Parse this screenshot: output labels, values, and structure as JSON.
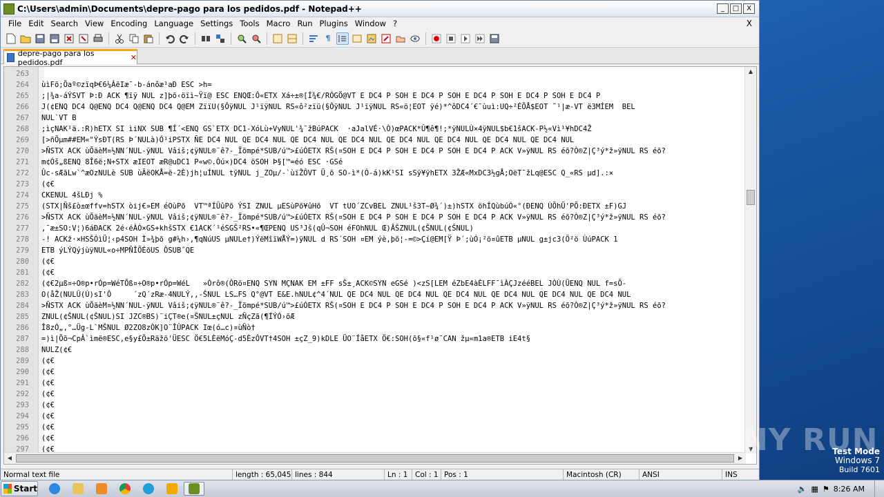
{
  "window": {
    "title": "C:\\Users\\admin\\Documents\\depre-pago para los pedidos.pdf - Notepad++",
    "min": "_",
    "max": "□",
    "close": "X"
  },
  "menu": {
    "items": [
      "File",
      "Edit",
      "Search",
      "View",
      "Encoding",
      "Language",
      "Settings",
      "Tools",
      "Macro",
      "Run",
      "Plugins",
      "Window",
      "?"
    ],
    "close": "X"
  },
  "tab": {
    "label": "depre-pago para los pedidos.pdf",
    "close": "✕"
  },
  "editor": {
    "lines": [
      {
        "n": "263",
        "t": ""
      },
      {
        "n": "264",
        "t": "ùìFõ;Õaº©zïqÞ€6¼ÁëIæ¯-b-ánôæ¹aÐ ESC >h="
      },
      {
        "n": "265",
        "t": ";|¾a-áÝSVT Þ:Ð ACK ¶ïÿ NUL z]þõ‹öïì~Ÿï@ ESC ENQŒ:Ô«ETX Xá÷±®[Í¾€/RÓGÖ@VT E DC4 P SOH E DC4 P SOH E DC4 P SOH E DC4 P SOH E DC4 P"
      },
      {
        "n": "266",
        "t": "J(¢ENQ DC4 Q@ENQ DC4 Q@ENQ DC4 Q@EM ZïïU(§ÔÿNUL J¹ïÿNUL RS«ô²zïü(§ÔÿNUL J¹ïÿNUL RS«ö¦EOT ÿé)*^ôDC4´€¯ùuì:UQ÷²ÉÕÅ$EOT ˜¹|æ-VT ë3MÍEM  BEL"
      },
      {
        "n": "267",
        "t": "NUL`VT B"
      },
      {
        "n": "268",
        "t": ";ìçNAK¹ä.:R)hETX SI ìiNX SUB ¶Í´<ENQ GS`ETX DC1-XóLù+VyNUL'¾¯žBúPACK  ·aJalVÉ·\\Ò)œPACK*Û¶ê¶!;*ÿNULÙ×4ÿNUL$b€1šACK-P½«Vì¹¥hDC4Ž"
      },
      {
        "n": "269",
        "t": "[>ñÕµm##EM«\"ÝsÐT(RS Þ´NULà)Ó¹iPSTX ÑE DC4 NUL QE DC4 NUL QE DC4 NUL QE DC4 NUL QE DC4 NUL QE DC4 NUL QE DC4 NUL QE DC4 NUL"
      },
      {
        "n": "270",
        "t": ">ÑSTX ACK ùÕäèM¤½NN´NUL-ÿNUL Vâiš;¢ÿNUL®¨ê?-_Ïõmpé*SUB/ú™>£úÓETX RŠ(¤SOH E DC4 P SOH E DC4 P SOH E DC4 P ACK V»ÿNUL RS éõ?Ò®Z|Ç³ý*ž»ÿNUL RS éõ?"
      },
      {
        "n": "271",
        "t": "m¢Óš„ßENQ 8Î6ë;N+STX æIEOT æR@uDC1 P«w©.Ôú×)DC4 öSOH Þ§[™=éó ESC ·GSé"
      },
      {
        "n": "272",
        "t": "Ûc-sÆãLw`^æOzNULè SUB ùÄëOKÅ=ë-2È)jh¦uÍNUL tÿNUL j_ZOµ/-`ùïŽÔVT Ü¸õ SO-ì*(Ó-á)kK¹SI sSÿ¥ÿhETX 3ŽÆ«MxDC3½gÅ;OëT¯žLq@ESC Q_«RS µd].:×"
      },
      {
        "n": "273",
        "t": "(¢€"
      },
      {
        "n": "274",
        "t": "CKENUL 4šLÐj %"
      },
      {
        "n": "275",
        "t": "(STX|Ñš£ò±œffv=hSTX òij€»EM éOùPõ  VT™ªÍÜûPõ ÝSI ZNUL µESùPõ¥ûHõ  VT tUO´ZCvBEL ZNUL¹š3T~Ø¾´)±)hSTX öhÍQùbúÓ«°(ÐENQ ÙÕhÜ'PÕ:ÐETX ±F)GJ"
      },
      {
        "n": "276",
        "t": ">ÑSTX ACK ùÕäèM¤½NN´NUL-ÿNUL Vâiš;¢ÿNUL®¨ê?-_Ïõmpé*SUB/ú™>£úÓETX RŠ(¤SOH E DC4 P SOH E DC4 P SOH E DC4 P ACK V»ÿNUL RS éõ?Ò®Z|Ç³ý*ž»ÿNUL RS éõ?"
      },
      {
        "n": "277",
        "t": ",¯æ±SO:V¦)6áÐACK 2é‹éÀÒ×GS+khšSTX €1ACK´¹éSGŠ²RS•«¶ŒPENQ US³Jš(qÛ¬SOH éFOhNUL Œ)ÂŠZNUL(¢ŠNUL(¢ŠNUL)"
      },
      {
        "n": "278",
        "t": "-! ACKž·×HSŠÓìÜ¦‹p4SOH Ì»¾þõ g#¼h›,¶qNúUS µNULe†)ÝëMîïWÅÝ=)ÿNUL d RS´SOH ¤EM ýè,þõ¦-=©>Çí@EM[Ÿ Þ´;ùÓ¡²ö¤ûETB µNUL g±jc3(Ö²ö ÙúPACK 1"
      },
      {
        "n": "279",
        "t": "ETB ýLÝQýjùÿNUL«o÷MPÑÎÕÉõUS ÔSUB˝QE"
      },
      {
        "n": "280",
        "t": "(¢€"
      },
      {
        "n": "281",
        "t": "(¢€"
      },
      {
        "n": "282",
        "t": "(¢€2µß¤÷O®p•rÓp=WéTÕß¤÷O®p•rÓp=WéL   »Òrô®(ÔRö¤ENQ SYN MÇNAK EM ±FF sŠ±¸ACK©SYN eGSé )<zS[LEM éZbE4àÈLFF¯ìÀÇJzééBEL JÒÙ(ÜENQ NUL f=sÕ-"
      },
      {
        "n": "283",
        "t": "O(åŽ(NULÛ(Ú)sI'Ô     ´zQ´zRæ-4NULÝ,‚-ŠNUL LS…FS Q°@VT E&E.hNUL¢^4´NUL QE DC4 NUL QE DC4 NUL QE DC4 NUL QE DC4 NUL QE DC4 NUL QE DC4 NUL"
      },
      {
        "n": "284",
        "t": ">ÑSTX ACK ùÕäèM¤½NN´NUL-ÿNUL Vâiš;¢ÿNUL®¨ê?-_Ïõmpé*SUB/ú™>£úÓETX RŠ(¤SOH E DC4 P SOH E DC4 P SOH E DC4 P ACK V»ÿNUL RS éõ?Ò®Z|Ç³ý*ž»ÿNUL RS éõ?"
      },
      {
        "n": "285",
        "t": "ZNUL(¢ŠNUL(¢ŠNUL)SI JZC®BS)¨iÇT®e(¤ŠNUL±çNUL zÑçZã(¶ÍÝÓ›õÆ"
      },
      {
        "n": "286",
        "t": "Î8zÓ„,°…Üg-L`MŠNUL Ø2ZO8zÒK]O¨ÎÛPACK Iœ(ó…c)¤ùÑò†"
      },
      {
        "n": "287",
        "t": "=)ì|Õõ¬CpÂ`ìmë®ESC,e§y£Ö±Räžö'ÜESC Ö€5LÈëMóÇ-d5ÈzÔVT†4SOH ±çZ_9)kDLE ÜO¨ÍåETX Ö€:SOH(õ§«f¹ø¯CAN žµ«m1a®ETB iE4t§"
      },
      {
        "n": "288",
        "t": "NULZ(¢€"
      },
      {
        "n": "289",
        "t": "(¢€"
      },
      {
        "n": "290",
        "t": "(¢€"
      },
      {
        "n": "291",
        "t": "(¢€"
      },
      {
        "n": "292",
        "t": "(¢€"
      },
      {
        "n": "293",
        "t": "(¢€"
      },
      {
        "n": "294",
        "t": "(¢€"
      },
      {
        "n": "295",
        "t": "(¢€"
      },
      {
        "n": "296",
        "t": "(¢€"
      },
      {
        "n": "297",
        "t": "(¢€"
      }
    ]
  },
  "status": {
    "type": "Normal text file",
    "length": "length : 65,045",
    "lines": "lines : 844",
    "ln": "Ln : 1",
    "col": "Col : 1",
    "pos": "Pos : 1",
    "eol": "Macintosh (CR)",
    "encoding": "ANSI",
    "mode": "INS"
  },
  "taskbar": {
    "start": "Start",
    "time": "8:26 AM"
  },
  "overlay": {
    "watermark": "ANY RUN",
    "testmode": [
      "Test Mode",
      "Windows 7",
      "Build 7601"
    ]
  }
}
